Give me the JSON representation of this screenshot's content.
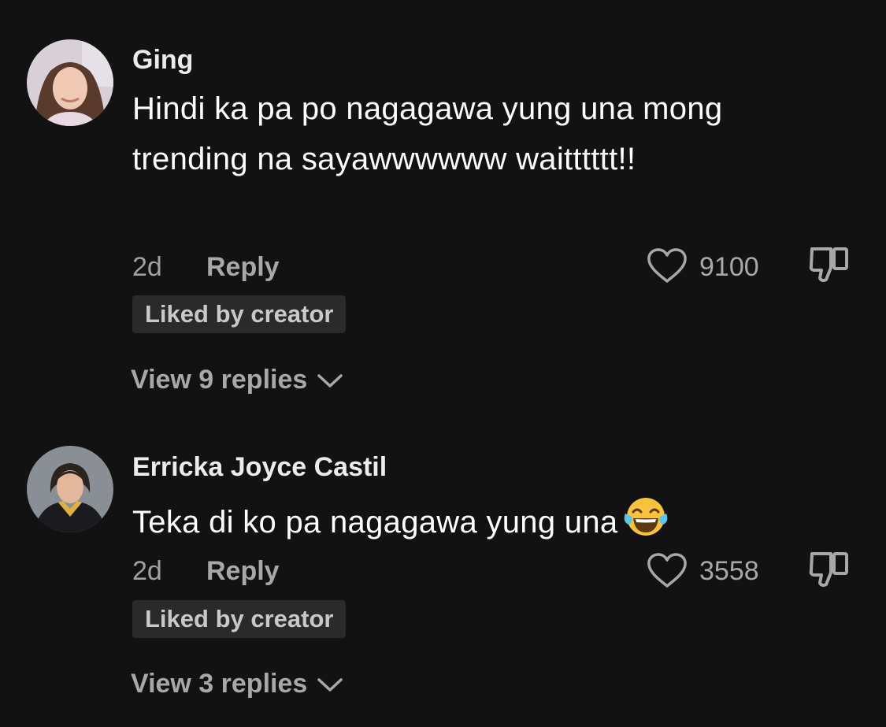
{
  "comments": [
    {
      "username": "Ging",
      "text": "Hindi ka pa po nagagawa yung una mong trending na sayawwwwww waitttttt!!",
      "time": "2d",
      "reply_label": "Reply",
      "like_count": "9100",
      "badge": "Liked by creator",
      "view_replies": "View 9 replies",
      "avatar_icon": "user-avatar-photo"
    },
    {
      "username": "Erricka Joyce Castil",
      "text": "Teka di ko pa nagagawa yung una",
      "emoji": "face-with-tears-of-joy",
      "time": "2d",
      "reply_label": "Reply",
      "like_count": "3558",
      "badge": "Liked by creator",
      "view_replies": "View 3 replies",
      "avatar_icon": "user-avatar-photo"
    }
  ],
  "colors": {
    "background": "#121212",
    "secondary_text": "#a8a8a8",
    "badge_bg": "#2a2a2a"
  }
}
